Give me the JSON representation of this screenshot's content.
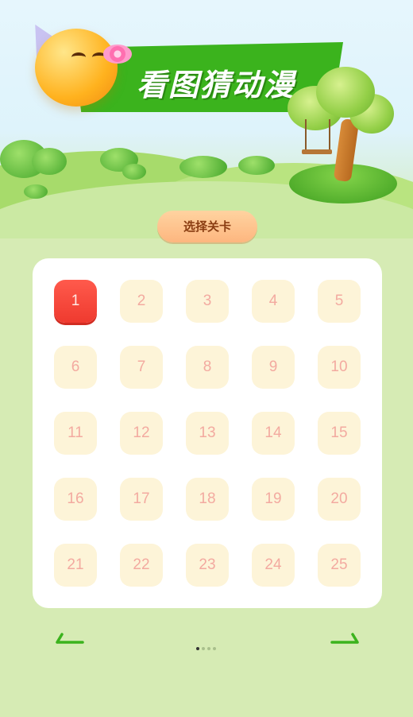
{
  "header": {
    "title": "看图猜动漫"
  },
  "level_select": {
    "label": "选择关卡"
  },
  "levels": [
    {
      "label": "1",
      "state": "active"
    },
    {
      "label": "2",
      "state": "locked"
    },
    {
      "label": "3",
      "state": "locked"
    },
    {
      "label": "4",
      "state": "locked"
    },
    {
      "label": "5",
      "state": "locked"
    },
    {
      "label": "6",
      "state": "locked"
    },
    {
      "label": "7",
      "state": "locked"
    },
    {
      "label": "8",
      "state": "locked"
    },
    {
      "label": "9",
      "state": "locked"
    },
    {
      "label": "10",
      "state": "locked"
    },
    {
      "label": "11",
      "state": "locked"
    },
    {
      "label": "12",
      "state": "locked"
    },
    {
      "label": "13",
      "state": "locked"
    },
    {
      "label": "14",
      "state": "locked"
    },
    {
      "label": "15",
      "state": "locked"
    },
    {
      "label": "16",
      "state": "locked"
    },
    {
      "label": "17",
      "state": "locked"
    },
    {
      "label": "18",
      "state": "locked"
    },
    {
      "label": "19",
      "state": "locked"
    },
    {
      "label": "20",
      "state": "locked"
    },
    {
      "label": "21",
      "state": "locked"
    },
    {
      "label": "22",
      "state": "locked"
    },
    {
      "label": "23",
      "state": "locked"
    },
    {
      "label": "24",
      "state": "locked"
    },
    {
      "label": "25",
      "state": "locked"
    }
  ],
  "pagination": {
    "page_count": 4,
    "current_page": 1,
    "prev_icon": "arrow-left-icon",
    "next_icon": "arrow-right-icon"
  },
  "colors": {
    "background": "#d6ebb4",
    "banner": "#3bb31d",
    "active_level": "#ef3a2f",
    "locked_level": "#fdf4d8",
    "locked_text": "#f3aaa0",
    "arrow": "#3bb31d"
  }
}
